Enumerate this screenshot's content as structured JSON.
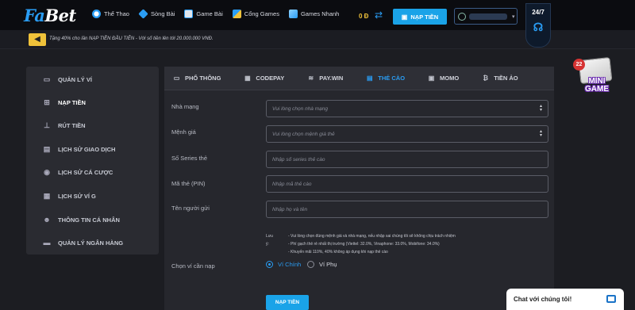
{
  "brand": {
    "logo_a": "Fa",
    "logo_b": "Bet"
  },
  "nav": [
    {
      "label": "Thể Thao",
      "icon": "soccer-icon",
      "color": "#2a9df4"
    },
    {
      "label": "Sòng Bài",
      "icon": "diamond-icon",
      "color": "#2a9df4"
    },
    {
      "label": "Game Bài",
      "icon": "cards-icon",
      "color": "#2a9df4"
    },
    {
      "label": "Cổng Games",
      "icon": "joystick-icon",
      "color": "#2a9df4"
    },
    {
      "label": "Games Nhanh",
      "icon": "lightning-icon",
      "color": "#2a9df4"
    }
  ],
  "header": {
    "balance": "0 Đ",
    "deposit_label": "NẠP TIỀN",
    "support_label": "24/7"
  },
  "announcement": "Tặng 40% cho lần NẠP TIỀN ĐẦU TIÊN - Với số tiền lên tới 20.000.000 VNĐ.",
  "sidebar": [
    {
      "label": "QUẢN LÝ VÍ",
      "icon": "wallet-icon",
      "active": false
    },
    {
      "label": "NẠP TIỀN",
      "icon": "deposit-icon",
      "active": true
    },
    {
      "label": "RÚT TIỀN",
      "icon": "withdraw-icon",
      "active": false
    },
    {
      "label": "LỊCH SỬ GIAO DỊCH",
      "icon": "receipt-icon",
      "active": false
    },
    {
      "label": "LỊCH SỬ CÁ CƯỢC",
      "icon": "ball-icon",
      "active": false
    },
    {
      "label": "LỊCH SỬ VÍ G",
      "icon": "history-icon",
      "active": false
    },
    {
      "label": "THÔNG TIN CÁ NHÂN",
      "icon": "user-icon",
      "active": false
    },
    {
      "label": "QUẢN LÝ NGÂN HÀNG",
      "icon": "bank-icon",
      "active": false
    }
  ],
  "tabs": [
    {
      "label": "PHỔ THÔNG",
      "icon": "bank-card-icon",
      "active": false
    },
    {
      "label": "CODEPAY",
      "icon": "qr-icon",
      "active": false
    },
    {
      "label": "PAY.WIN",
      "icon": "paywin-icon",
      "active": false
    },
    {
      "label": "THẺ CÀO",
      "icon": "scratch-card-icon",
      "active": true
    },
    {
      "label": "MOMO",
      "icon": "momo-icon",
      "active": false
    },
    {
      "label": "TIỀN ẢO",
      "icon": "bitcoin-icon",
      "active": false
    }
  ],
  "form": {
    "carrier": {
      "label": "Nhà mạng",
      "placeholder": "Vui lòng chọn nhà mạng"
    },
    "amount": {
      "label": "Mệnh giá",
      "placeholder": "Vui lòng chọn mệnh giá thẻ"
    },
    "serial": {
      "label": "Số Series thẻ",
      "placeholder": "Nhập số series thẻ cào"
    },
    "pin": {
      "label": "Mã thẻ (PIN)",
      "placeholder": "Nhập mã thẻ cào"
    },
    "sender": {
      "label": "Tên người gửi",
      "placeholder": "Nhập họ và tên"
    },
    "notes_label": "Lưu ý:",
    "notes": [
      "- Vui lòng chọn đúng mệnh giá và nhà mạng, nếu nhập sai chúng tôi sẽ không chịu trách nhiệm",
      "- Phí gạch thẻ rẻ nhất thị trường (Viettel: 32.0%, Vinaphone: 33.0%, Mobifone: 34.0%)",
      "- Khuyến mãi 110%, 40% không áp dụng khi nạp thẻ cào"
    ],
    "wallet_label": "Chọn ví cần nạp",
    "wallet_main": "Ví Chính",
    "wallet_sub": "Ví Phụ",
    "submit_label": "NẠP TIỀN"
  },
  "minigame": {
    "badge": "22",
    "text": "MINI GAME"
  },
  "chat": {
    "label": "Chat với chúng tôi!"
  }
}
